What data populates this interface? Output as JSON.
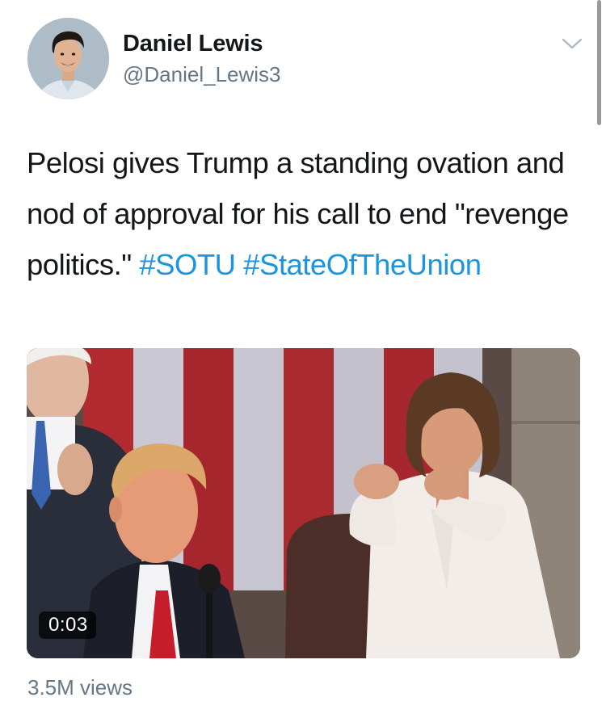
{
  "author": {
    "display_name": "Daniel Lewis",
    "handle": "@Daniel_Lewis3",
    "avatar_icon": "profile-photo"
  },
  "menu_icon": "chevron-down-icon",
  "tweet": {
    "text_parts": [
      {
        "kind": "text",
        "value": "Pelosi gives Trump a standing ovation and nod of approval for his call to end \"revenge politics.\" "
      },
      {
        "kind": "hashtag",
        "value": "#SOTU"
      },
      {
        "kind": "text",
        "value": " "
      },
      {
        "kind": "hashtag",
        "value": "#StateOfTheUnion"
      }
    ]
  },
  "media": {
    "type": "video",
    "timestamp": "0:03"
  },
  "stats": {
    "views": "3.5M views"
  },
  "colors": {
    "text": "#14171a",
    "secondary": "#657786",
    "link": "#1b95e0"
  }
}
